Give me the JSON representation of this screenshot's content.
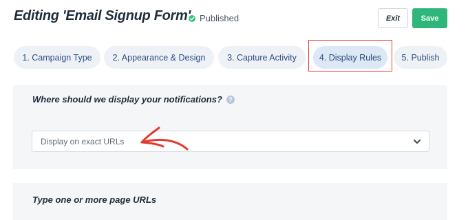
{
  "header": {
    "title": "Editing 'Email Signup Form'",
    "status": "Published",
    "status_color": "#3dbf80",
    "exit_label": "Exit",
    "save_label": "Save",
    "save_color": "#2fb67b"
  },
  "tabs": [
    {
      "label": "1. Campaign Type",
      "active": false
    },
    {
      "label": "2. Appearance & Design",
      "active": false
    },
    {
      "label": "3. Capture Activity",
      "active": false
    },
    {
      "label": "4. Display Rules",
      "active": true
    },
    {
      "label": "5. Publish",
      "active": false
    }
  ],
  "display_section": {
    "question": "Where should we display your notifications?",
    "help_icon": "question-circle-icon",
    "select_value": "Display on exact URLs",
    "dropdown_icon": "chevron-down-icon"
  },
  "urls_section": {
    "label": "Type one or more page URLs"
  },
  "annotations": {
    "highlight_color": "#e03b2f",
    "arrow_icon": "red-arrow-icon"
  }
}
